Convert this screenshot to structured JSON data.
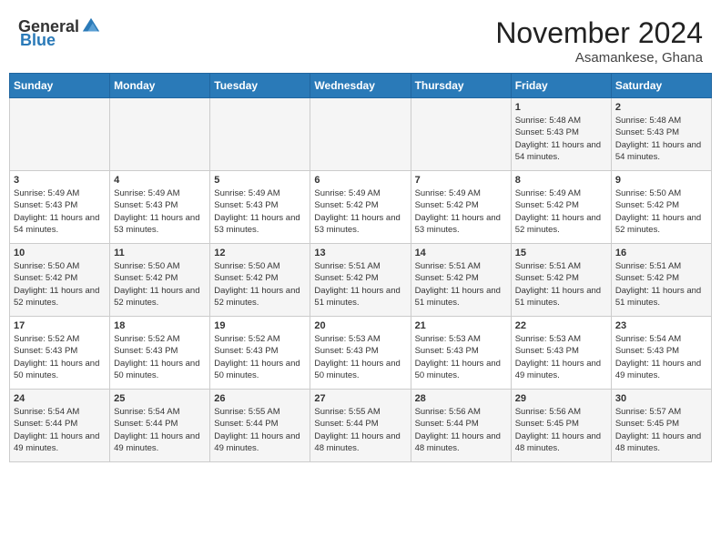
{
  "header": {
    "logo_general": "General",
    "logo_blue": "Blue",
    "month_year": "November 2024",
    "location": "Asamankese, Ghana"
  },
  "calendar": {
    "days_of_week": [
      "Sunday",
      "Monday",
      "Tuesday",
      "Wednesday",
      "Thursday",
      "Friday",
      "Saturday"
    ],
    "weeks": [
      [
        {
          "day": "",
          "info": ""
        },
        {
          "day": "",
          "info": ""
        },
        {
          "day": "",
          "info": ""
        },
        {
          "day": "",
          "info": ""
        },
        {
          "day": "",
          "info": ""
        },
        {
          "day": "1",
          "sunrise": "5:48 AM",
          "sunset": "5:43 PM",
          "daylight": "11 hours and 54 minutes."
        },
        {
          "day": "2",
          "sunrise": "5:48 AM",
          "sunset": "5:43 PM",
          "daylight": "11 hours and 54 minutes."
        }
      ],
      [
        {
          "day": "3",
          "sunrise": "5:49 AM",
          "sunset": "5:43 PM",
          "daylight": "11 hours and 54 minutes."
        },
        {
          "day": "4",
          "sunrise": "5:49 AM",
          "sunset": "5:43 PM",
          "daylight": "11 hours and 53 minutes."
        },
        {
          "day": "5",
          "sunrise": "5:49 AM",
          "sunset": "5:43 PM",
          "daylight": "11 hours and 53 minutes."
        },
        {
          "day": "6",
          "sunrise": "5:49 AM",
          "sunset": "5:42 PM",
          "daylight": "11 hours and 53 minutes."
        },
        {
          "day": "7",
          "sunrise": "5:49 AM",
          "sunset": "5:42 PM",
          "daylight": "11 hours and 53 minutes."
        },
        {
          "day": "8",
          "sunrise": "5:49 AM",
          "sunset": "5:42 PM",
          "daylight": "11 hours and 52 minutes."
        },
        {
          "day": "9",
          "sunrise": "5:50 AM",
          "sunset": "5:42 PM",
          "daylight": "11 hours and 52 minutes."
        }
      ],
      [
        {
          "day": "10",
          "sunrise": "5:50 AM",
          "sunset": "5:42 PM",
          "daylight": "11 hours and 52 minutes."
        },
        {
          "day": "11",
          "sunrise": "5:50 AM",
          "sunset": "5:42 PM",
          "daylight": "11 hours and 52 minutes."
        },
        {
          "day": "12",
          "sunrise": "5:50 AM",
          "sunset": "5:42 PM",
          "daylight": "11 hours and 52 minutes."
        },
        {
          "day": "13",
          "sunrise": "5:51 AM",
          "sunset": "5:42 PM",
          "daylight": "11 hours and 51 minutes."
        },
        {
          "day": "14",
          "sunrise": "5:51 AM",
          "sunset": "5:42 PM",
          "daylight": "11 hours and 51 minutes."
        },
        {
          "day": "15",
          "sunrise": "5:51 AM",
          "sunset": "5:42 PM",
          "daylight": "11 hours and 51 minutes."
        },
        {
          "day": "16",
          "sunrise": "5:51 AM",
          "sunset": "5:42 PM",
          "daylight": "11 hours and 51 minutes."
        }
      ],
      [
        {
          "day": "17",
          "sunrise": "5:52 AM",
          "sunset": "5:43 PM",
          "daylight": "11 hours and 50 minutes."
        },
        {
          "day": "18",
          "sunrise": "5:52 AM",
          "sunset": "5:43 PM",
          "daylight": "11 hours and 50 minutes."
        },
        {
          "day": "19",
          "sunrise": "5:52 AM",
          "sunset": "5:43 PM",
          "daylight": "11 hours and 50 minutes."
        },
        {
          "day": "20",
          "sunrise": "5:53 AM",
          "sunset": "5:43 PM",
          "daylight": "11 hours and 50 minutes."
        },
        {
          "day": "21",
          "sunrise": "5:53 AM",
          "sunset": "5:43 PM",
          "daylight": "11 hours and 50 minutes."
        },
        {
          "day": "22",
          "sunrise": "5:53 AM",
          "sunset": "5:43 PM",
          "daylight": "11 hours and 49 minutes."
        },
        {
          "day": "23",
          "sunrise": "5:54 AM",
          "sunset": "5:43 PM",
          "daylight": "11 hours and 49 minutes."
        }
      ],
      [
        {
          "day": "24",
          "sunrise": "5:54 AM",
          "sunset": "5:44 PM",
          "daylight": "11 hours and 49 minutes."
        },
        {
          "day": "25",
          "sunrise": "5:54 AM",
          "sunset": "5:44 PM",
          "daylight": "11 hours and 49 minutes."
        },
        {
          "day": "26",
          "sunrise": "5:55 AM",
          "sunset": "5:44 PM",
          "daylight": "11 hours and 49 minutes."
        },
        {
          "day": "27",
          "sunrise": "5:55 AM",
          "sunset": "5:44 PM",
          "daylight": "11 hours and 48 minutes."
        },
        {
          "day": "28",
          "sunrise": "5:56 AM",
          "sunset": "5:44 PM",
          "daylight": "11 hours and 48 minutes."
        },
        {
          "day": "29",
          "sunrise": "5:56 AM",
          "sunset": "5:45 PM",
          "daylight": "11 hours and 48 minutes."
        },
        {
          "day": "30",
          "sunrise": "5:57 AM",
          "sunset": "5:45 PM",
          "daylight": "11 hours and 48 minutes."
        }
      ]
    ],
    "labels": {
      "sunrise": "Sunrise:",
      "sunset": "Sunset:",
      "daylight": "Daylight:"
    }
  }
}
